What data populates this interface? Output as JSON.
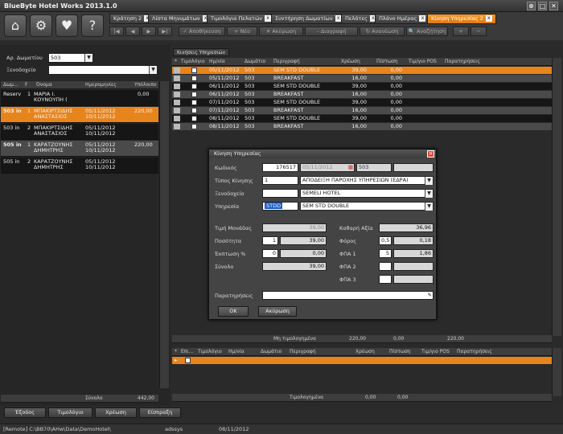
{
  "window": {
    "title": "BlueByte Hotel Works 2013.1.0"
  },
  "tabs": [
    {
      "label": "Κράτηση 2"
    },
    {
      "label": "Λίστα Μηνυμάτων"
    },
    {
      "label": "Τιμολόγια Πελατών"
    },
    {
      "label": "Συντήρηση Δωματίων"
    },
    {
      "label": "Πελάτες"
    },
    {
      "label": "Πλάνο Ημέρας"
    },
    {
      "label": "Κίνηση Υπηρεσίας 2"
    }
  ],
  "tab_close": "x",
  "nav": {
    "first": "|◀",
    "prev": "◀",
    "next": "▶",
    "last": "▶|",
    "save": "✓ Αποθήκευση",
    "new": "+ Νέο",
    "cancel": "✕ Ακύρωση",
    "delete": "– Διαγραφή",
    "refresh": "↻ Ανανέωση",
    "search": "🔍 Αναζήτηση"
  },
  "left": {
    "room_label": "Αρ. Δωματίου",
    "room_value": "503",
    "hotel_label": "Ξενοδοχείο",
    "hotel_value": "",
    "columns": [
      "Δωμ...",
      "F",
      "Όνομα",
      "Ημερομηνίες",
      "Υπόλοιπο"
    ],
    "rows": [
      {
        "room": "Reserv",
        "f": "1",
        "name": "ΜΑΡΙΑ Ι. ΚΟΥΝΟΥΠΗ (",
        "date1": "",
        "date2": "",
        "balance": "0,00"
      },
      {
        "room": "503 in",
        "f": "1",
        "name": "ΜΠΑΚΙΡΤΣΙΔΗΣ ΑΝΑΣΤΑΣΙΟΣ",
        "date1": "05/11/2012",
        "date2": "10/11/2012",
        "balance": "220,00"
      },
      {
        "room": "503 in",
        "f": "2",
        "name": "ΜΠΑΚΙΡΤΣΙΔΗΣ ΑΝΑΣΤΑΣΙΟΣ",
        "date1": "05/11/2012",
        "date2": "10/11/2012",
        "balance": ""
      },
      {
        "room": "505 in",
        "f": "1",
        "name": "ΚΑΡΑΤΖΟΥΝΗΣ ΔΗΜΗΤΡΗΣ",
        "date1": "05/11/2012",
        "date2": "10/11/2012",
        "balance": "220,00"
      },
      {
        "room": "505 in",
        "f": "2",
        "name": "ΚΑΡΑΤΖΟΥΝΗΣ ΔΗΜΗΤΡΗΣ",
        "date1": "05/11/2012",
        "date2": "10/11/2012",
        "balance": ""
      }
    ],
    "total_label": "Σύνολο",
    "total_value": "442,00"
  },
  "main": {
    "tab_label": "Κινήσεις Υπηρεσιών",
    "columns": [
      "Τιμολόγιο",
      "Ημ/νία",
      "Δωμάτιο",
      "Περιγραφή",
      "Χρέωση",
      "Πίστωση",
      "Τιμ/γιο POS",
      "Παρατηρήσεις"
    ],
    "rows": [
      {
        "date": "05/11/2012",
        "room": "503",
        "desc": "SEM STD DOUBLE",
        "charge": "39,00",
        "credit": "0,00"
      },
      {
        "date": "05/11/2012",
        "room": "503",
        "desc": "BREAKFAST",
        "charge": "16,00",
        "credit": "0,00"
      },
      {
        "date": "06/11/2012",
        "room": "503",
        "desc": "SEM STD DOUBLE",
        "charge": "39,00",
        "credit": "0,00"
      },
      {
        "date": "06/11/2012",
        "room": "503",
        "desc": "BREAKFAST",
        "charge": "16,00",
        "credit": "0,00"
      },
      {
        "date": "07/11/2012",
        "room": "503",
        "desc": "SEM STD DOUBLE",
        "charge": "39,00",
        "credit": "0,00"
      },
      {
        "date": "07/11/2012",
        "room": "503",
        "desc": "BREAKFAST",
        "charge": "16,00",
        "credit": "0,00"
      },
      {
        "date": "08/11/2012",
        "room": "503",
        "desc": "SEM STD DOUBLE",
        "charge": "39,00",
        "credit": "0,00"
      },
      {
        "date": "08/11/2012",
        "room": "503",
        "desc": "BREAKFAST",
        "charge": "16,00",
        "credit": "0,00"
      }
    ],
    "summary_label": "Μη τιμολογημένα",
    "summary_charge": "220,00",
    "summary_credit": "0,00",
    "summary_total": "220,00",
    "bottom_columns": [
      "Επι...",
      "Τιμολόγιο",
      "Ημ/νία",
      "Δωμάτιο",
      "Περιγραφή",
      "Χρέωση",
      "Πίστωση",
      "Τιμ/γιο POS",
      "Παρατηρήσεις"
    ],
    "bottom_summary_label": "Τιμολογημένα",
    "bottom_summary_charge": "0,00",
    "bottom_summary_credit": "0,00"
  },
  "dialog": {
    "title": "Κίνηση Υπηρεσίας",
    "code_label": "Κωδικός",
    "code_value": "176517",
    "date_value": "05/11/2012",
    "room_value": "503",
    "type_label": "Τύπος Κίνησης",
    "type_code": "1",
    "type_value": "ΑΠΟΔΕΙΞΗ ΠΑΡΟΧΗΣ ΥΠΗΡΕΣΙΩΝ (ΕΔΡΑ)",
    "hotel_label": "Ξενοδοχείο",
    "hotel_value": "SEMELI HOTEL",
    "service_label": "Υπηρεσία",
    "service_code": "STDD",
    "service_value": "SEM STD DOUBLE",
    "unit_price_label": "Τιμή Μονάδας",
    "unit_price": "39,00",
    "net_label": "Καθαρή Αξία",
    "net_value": "36,96",
    "qty_label": "Ποσότητα",
    "qty": "1",
    "qty_amount": "39,00",
    "tax_label": "Φόρος",
    "tax_rate": "0,5",
    "tax_value": "0,18",
    "discount_label": "Έκπτωση %",
    "discount": "0",
    "discount_amount": "0,00",
    "vat1_label": "ΦΠΑ 1",
    "vat1_rate": "5",
    "vat1_value": "1,86",
    "total_label": "Σύνολο",
    "total_value": "39,00",
    "vat2_label": "ΦΠΑ 2",
    "vat3_label": "ΦΠΑ 3",
    "notes_label": "Παρατηρήσεις",
    "ok": "OK",
    "cancel": "Ακύρωση"
  },
  "bottom_buttons": [
    "Έξοδος",
    "Τιμολόγιο",
    "Χρέωση",
    "Είσπραξη"
  ],
  "status": {
    "path": "[Remote] C:\\BB70\\AHw\\Data\\DemoHotel\\",
    "user": "adssys",
    "date": "08/11/2012"
  },
  "colors": {
    "accent": "#e8841c",
    "selection": "#1b5dc9"
  }
}
